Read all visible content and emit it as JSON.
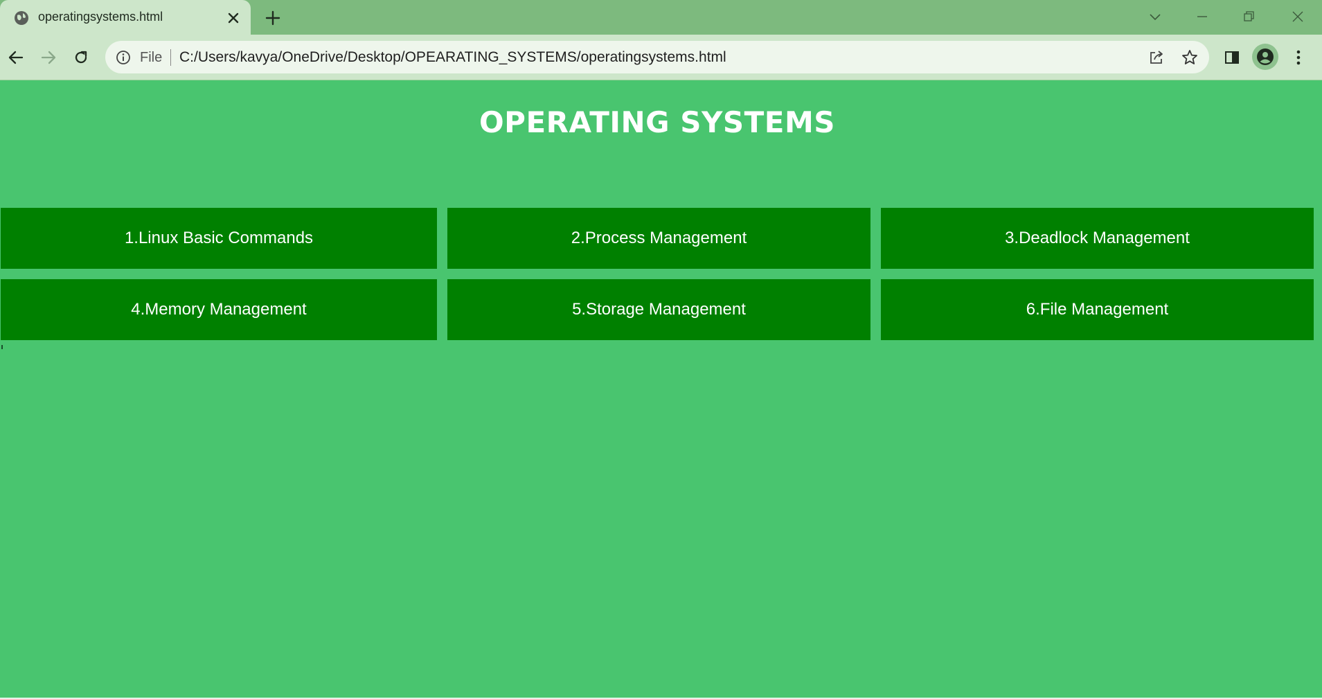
{
  "browser": {
    "tab_title": "operatingsystems.html",
    "omnibox": {
      "scheme_label": "File",
      "url": "C:/Users/kavya/OneDrive/Desktop/OPEARATING_SYSTEMS/operatingsystems.html"
    }
  },
  "page": {
    "title": "OPERATING SYSTEMS",
    "menu": [
      {
        "label": "1.Linux Basic Commands"
      },
      {
        "label": "2.Process Management"
      },
      {
        "label": "3.Deadlock Management"
      },
      {
        "label": "4.Memory Management"
      },
      {
        "label": "5.Storage Management"
      },
      {
        "label": "6.File Management"
      }
    ]
  },
  "colors": {
    "page_background": "#49c56f",
    "menu_button": "#008000",
    "tabstrip": "#7dba7e",
    "toolbar": "#cde6ca"
  }
}
